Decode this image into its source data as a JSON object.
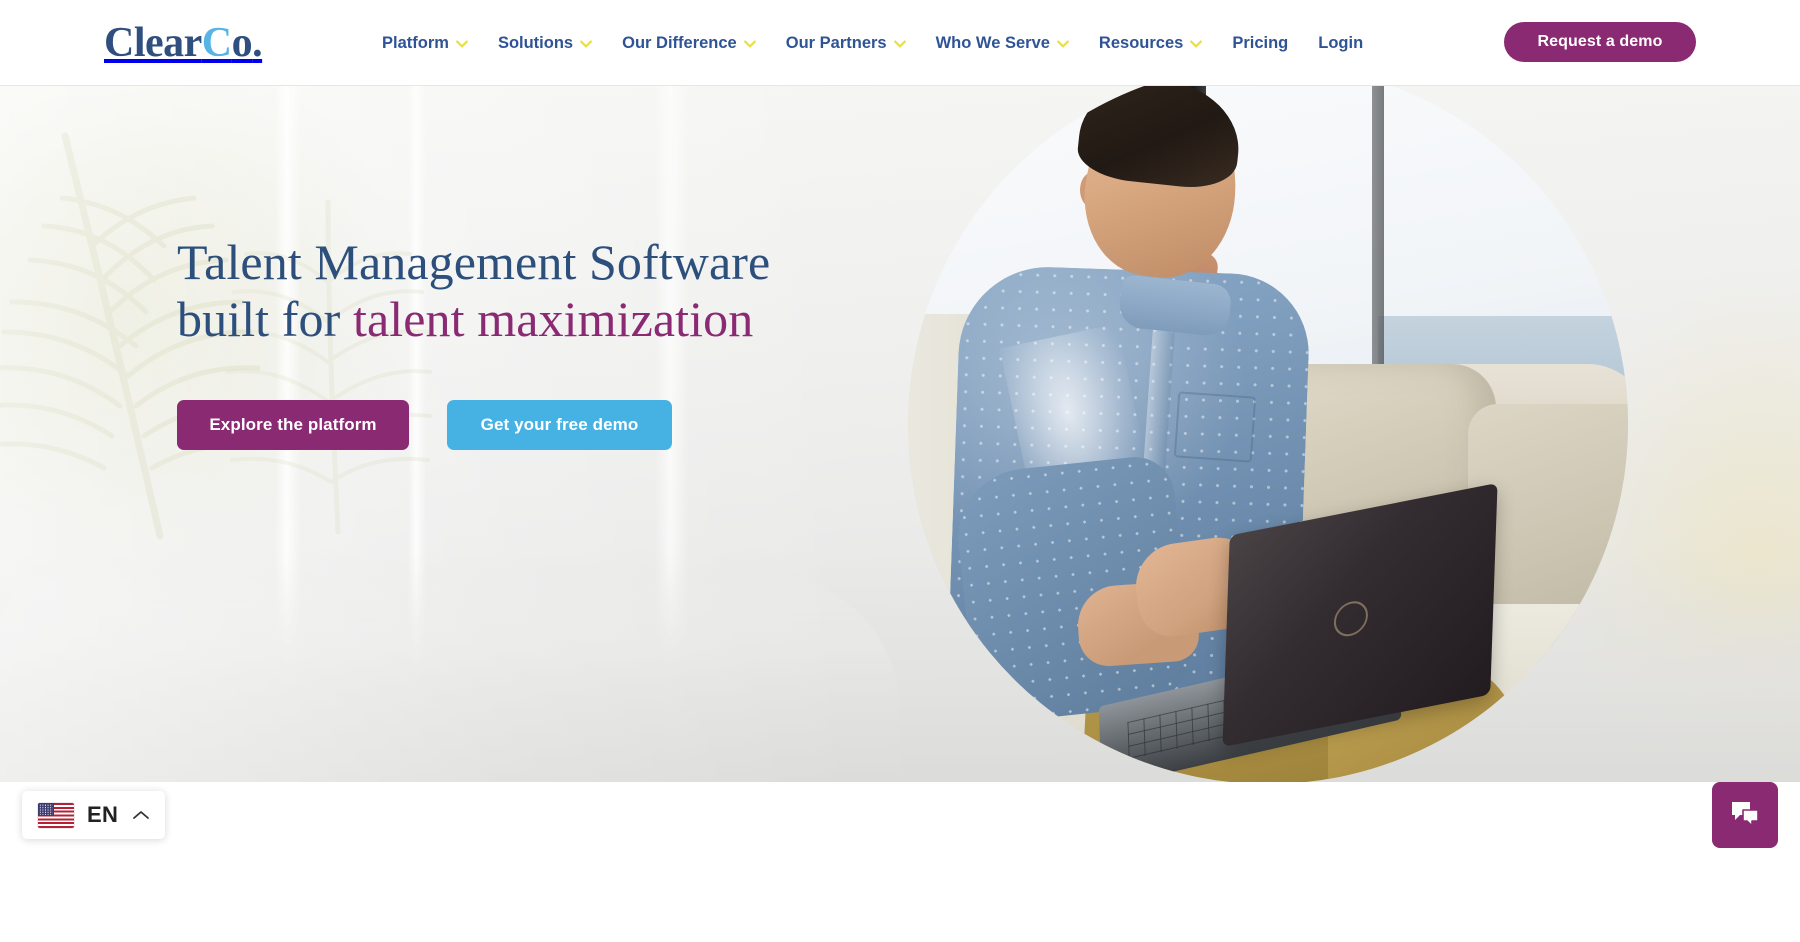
{
  "brand": {
    "logo_clear": "Clear",
    "logo_c": "C",
    "logo_o": "o",
    "logo_dot": ".",
    "accent_purple": "#8a2a72",
    "accent_blue": "#46b1e3",
    "navy": "#2d4f7c",
    "chevron_yellow": "#e9de3f",
    "nav_blue": "#2f5496"
  },
  "header": {
    "nav": [
      {
        "label": "Platform",
        "has_dropdown": true,
        "icon": "chevron-down-icon"
      },
      {
        "label": "Solutions",
        "has_dropdown": true,
        "icon": "chevron-down-icon"
      },
      {
        "label": "Our Difference",
        "has_dropdown": true,
        "icon": "chevron-down-icon"
      },
      {
        "label": "Our Partners",
        "has_dropdown": true,
        "icon": "chevron-down-icon"
      },
      {
        "label": "Who We Serve",
        "has_dropdown": true,
        "icon": "chevron-down-icon"
      },
      {
        "label": "Resources",
        "has_dropdown": true,
        "icon": "chevron-down-icon"
      },
      {
        "label": "Pricing",
        "has_dropdown": false,
        "icon": ""
      },
      {
        "label": "Login",
        "has_dropdown": false,
        "icon": ""
      }
    ],
    "demo_button": "Request a demo"
  },
  "hero": {
    "headline_line1": "Talent Management Software",
    "headline_line2_dark": "built for ",
    "headline_line2_accent": "talent maximization",
    "cta_primary": "Explore the platform",
    "cta_secondary": "Get your free demo",
    "image_alt": "Man in blue denim shirt working on a laptop while sitting on a couch by a window"
  },
  "language_switcher": {
    "code": "EN",
    "flag": "us-flag-icon",
    "caret": "chevron-up-icon"
  },
  "chat_widget": {
    "icon": "chat-bubbles-icon",
    "label": "Open chat"
  }
}
